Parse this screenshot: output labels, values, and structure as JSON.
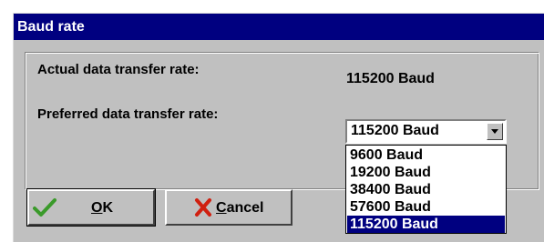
{
  "window": {
    "title": "Baud rate"
  },
  "fields": {
    "actual_label": "Actual data transfer rate:",
    "actual_value": "115200 Baud",
    "preferred_label": "Preferred data transfer rate:"
  },
  "combo": {
    "selected_value": "115200 Baud",
    "options": [
      "9600 Baud",
      "19200 Baud",
      "38400 Baud",
      "57600 Baud",
      "115200 Baud"
    ],
    "highlighted_index": 4
  },
  "buttons": {
    "ok_mnemonic": "O",
    "ok_rest": "K",
    "cancel_mnemonic": "C",
    "cancel_rest": "ancel"
  },
  "icons": {
    "ok": "checkmark-icon",
    "cancel": "x-cross-icon",
    "dropdown": "chevron-down-icon"
  },
  "colors": {
    "titlebar": "#000080",
    "face": "#c0c0c0",
    "selection": "#000080",
    "check": "#3a9a2a",
    "cross": "#d02010"
  }
}
